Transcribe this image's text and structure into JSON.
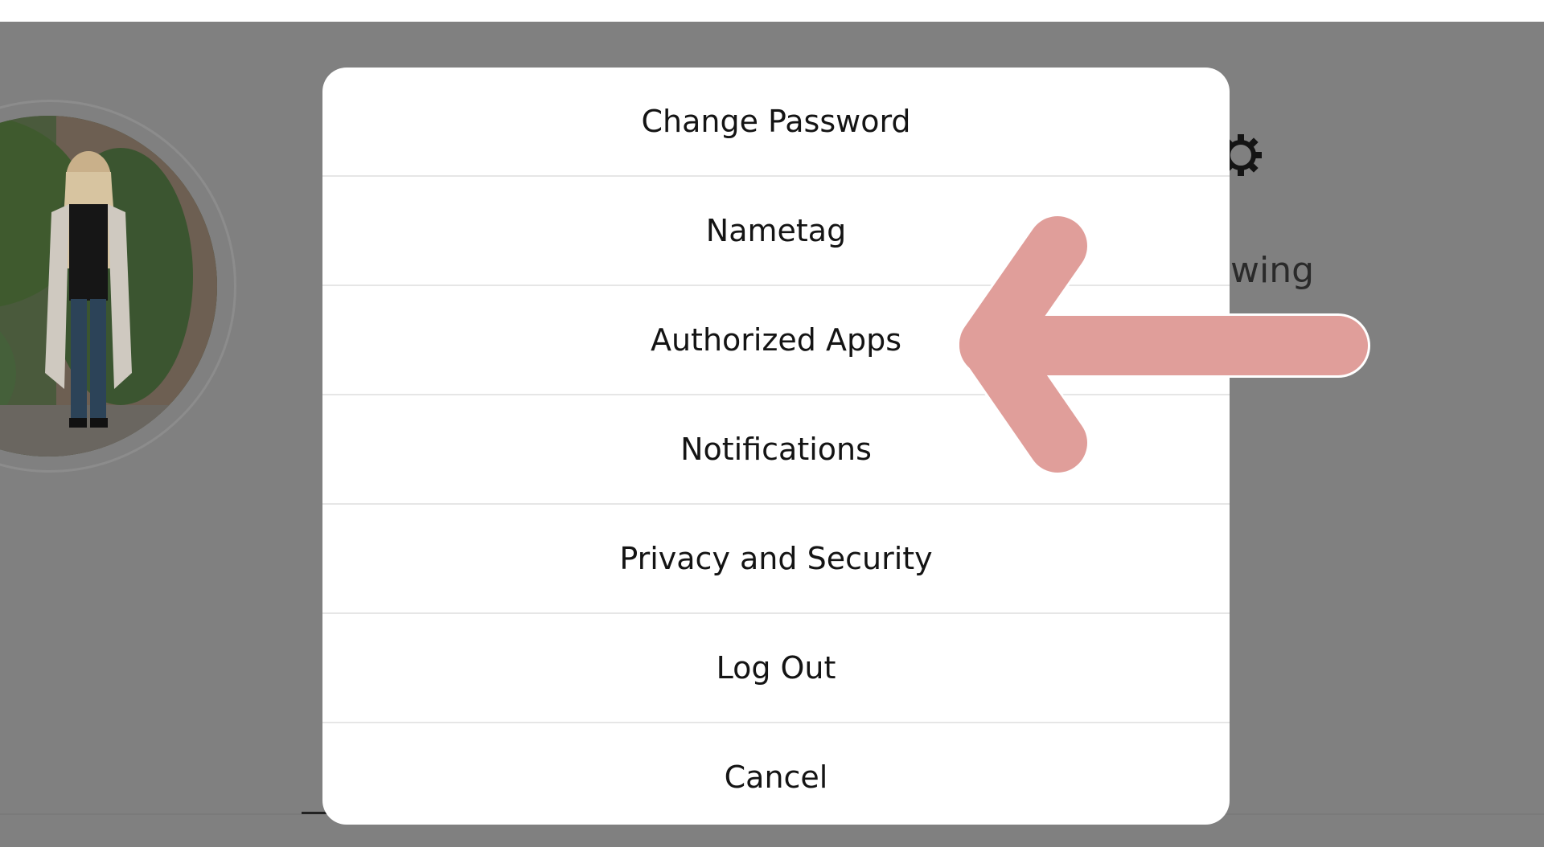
{
  "background": {
    "partial_text": "wing"
  },
  "menu": {
    "items": [
      {
        "label": "Change Password"
      },
      {
        "label": "Nametag"
      },
      {
        "label": "Authorized Apps"
      },
      {
        "label": "Notifications"
      },
      {
        "label": "Privacy and Security"
      },
      {
        "label": "Log Out"
      },
      {
        "label": "Cancel"
      }
    ]
  },
  "annotation": {
    "arrow_color": "#e09e9a",
    "target_item": "Authorized Apps"
  },
  "colors": {
    "overlay": "#808080",
    "menu_bg": "#ffffff",
    "divider": "#e6e6e6",
    "text": "#141414"
  },
  "icons": [
    "gear-icon",
    "arrow-left-icon",
    "profile-avatar"
  ]
}
